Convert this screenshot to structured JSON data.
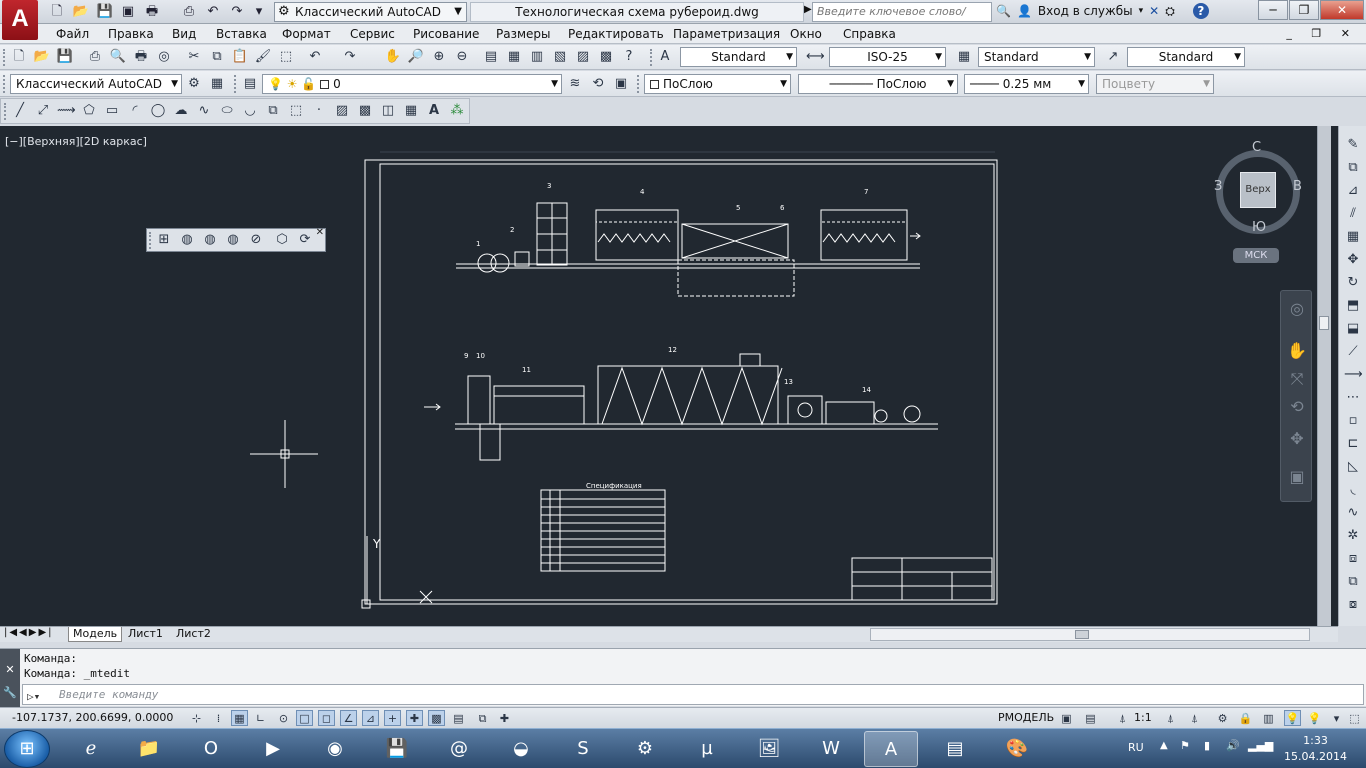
{
  "title_bar": {
    "app_logo": "A",
    "workspace": "Классический AutoCAD",
    "document_title": "Технологическая схема рубероид.dwg",
    "search_placeholder": "Введите ключевое слово/фразу",
    "sign_in": "Вход в службы",
    "help": "?"
  },
  "menu": {
    "items": [
      "Файл",
      "Правка",
      "Вид",
      "Вставка",
      "Формат",
      "Сервис",
      "Рисование",
      "Размеры",
      "Редактировать",
      "Параметризация",
      "Окно",
      "Справка"
    ]
  },
  "styles_toolbar": {
    "text_style": "Standard",
    "dim_style": "ISO-25",
    "table_style": "Standard",
    "multileader_style": "Standard"
  },
  "workspace_toolbar": {
    "workspace": "Классический AutoCAD"
  },
  "layers_toolbar": {
    "current_layer": "0"
  },
  "properties_toolbar": {
    "color": "ПоСлою",
    "linetype": "ПоСлою",
    "lineweight": "0.25 мм",
    "plot_style": "Поцвету"
  },
  "viewport": {
    "label": "[−][Верхняя][2D каркас]"
  },
  "viewcube": {
    "north": "С",
    "south": "Ю",
    "west": "З",
    "east": "В",
    "face": "Верх",
    "ucs": "МСК"
  },
  "drawing": {
    "ucs_y": "Y",
    "ucs_x": "X",
    "spec_table_title": "Спецификация",
    "callouts_top": [
      "1",
      "2",
      "3",
      "4",
      "5",
      "6",
      "7"
    ],
    "callouts_bottom": [
      "9",
      "10",
      "11",
      "12",
      "13",
      "14"
    ]
  },
  "layout_tabs": {
    "tabs": [
      "Модель",
      "Лист1",
      "Лист2"
    ],
    "active": "Модель"
  },
  "command_line": {
    "history": [
      "Команда:",
      "Команда:  _mtedit"
    ],
    "placeholder": "Введите команду"
  },
  "status_bar": {
    "coordinates": "-107.1737, 200.6699, 0.0000",
    "space": "РМОДЕЛЬ",
    "scale": "1:1"
  },
  "taskbar": {
    "language": "RU",
    "time": "1:33",
    "date": "15.04.2014"
  },
  "colors": {
    "viewport_bg": "#212830",
    "drawing_lines": "#ffffff",
    "autocad_red": "#c0262d"
  }
}
